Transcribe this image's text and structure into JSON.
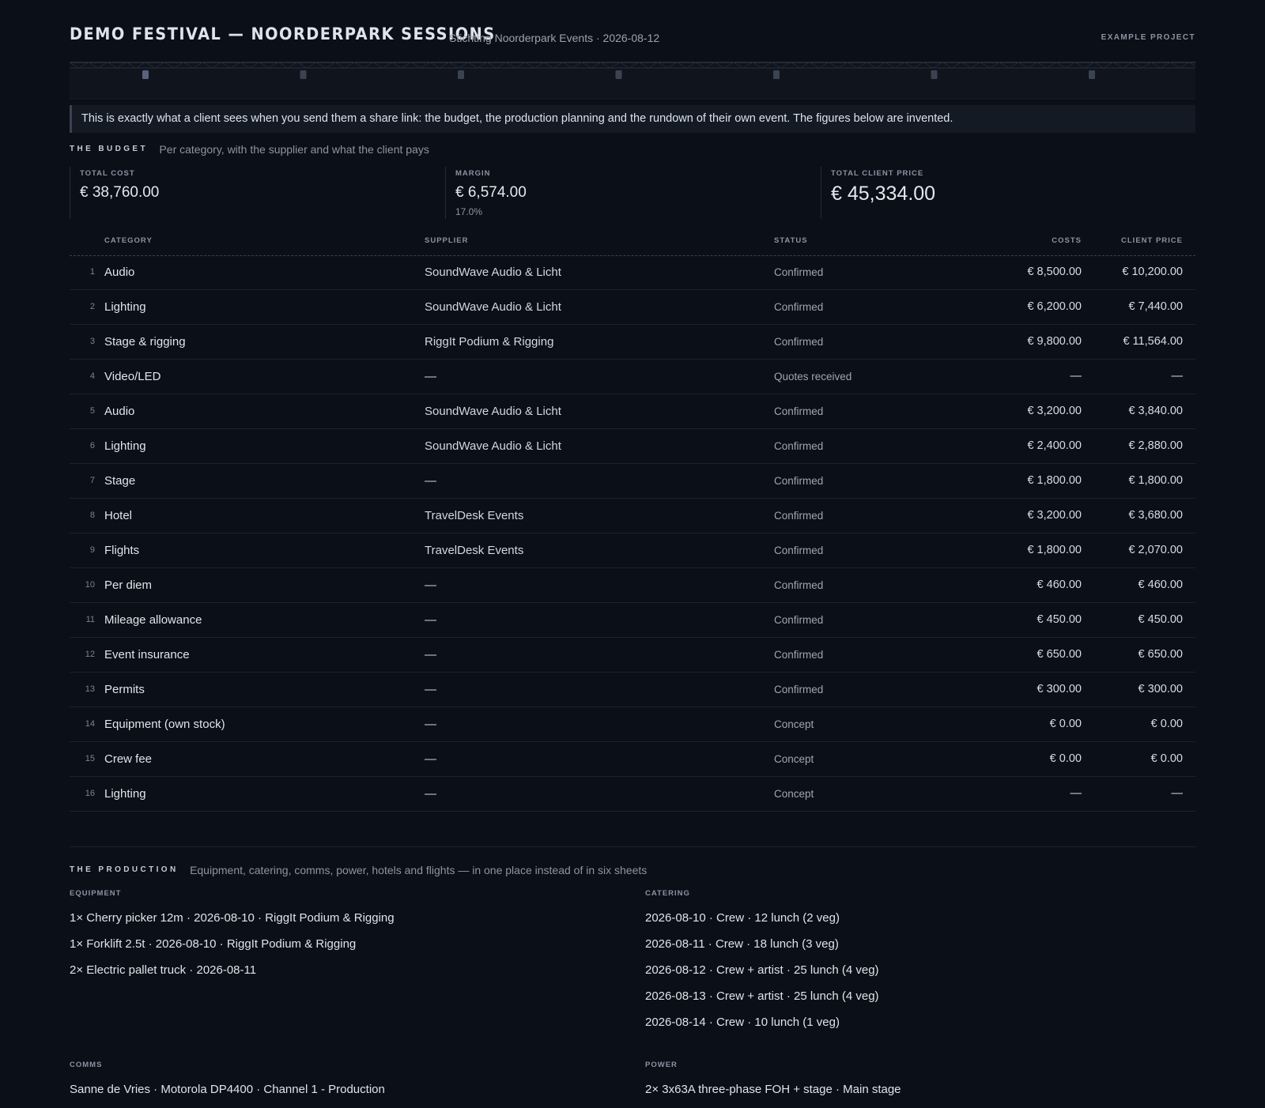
{
  "header": {
    "title": "DEMO FESTIVAL — NOORDERPARK SESSIONS",
    "subtitle": "Stichting Noorderpark Events · 2026-08-12",
    "tag": "EXAMPLE PROJECT"
  },
  "notice": "This is exactly what a client sees when you send them a share link: the budget, the production planning and the rundown of their own event. The figures below are invented.",
  "budget": {
    "heading": "THE BUDGET",
    "description": "Per category, with the supplier and what the client pays",
    "stats": {
      "total_cost": {
        "label": "TOTAL COST",
        "value": "€ 38,760.00"
      },
      "margin": {
        "label": "MARGIN",
        "value": "€ 6,574.00",
        "pct": "17.0%"
      },
      "total_client": {
        "label": "TOTAL CLIENT PRICE",
        "value": "€ 45,334.00"
      }
    },
    "columns": {
      "category": "CATEGORY",
      "supplier": "SUPPLIER",
      "status": "STATUS",
      "costs": "COSTS",
      "client_price": "CLIENT PRICE"
    },
    "rows": [
      {
        "n": "1",
        "category": "Audio",
        "supplier": "SoundWave Audio & Licht",
        "status": "Confirmed",
        "costs": "€ 8,500.00",
        "client": "€ 10,200.00"
      },
      {
        "n": "2",
        "category": "Lighting",
        "supplier": "SoundWave Audio & Licht",
        "status": "Confirmed",
        "costs": "€ 6,200.00",
        "client": "€ 7,440.00"
      },
      {
        "n": "3",
        "category": "Stage & rigging",
        "supplier": "RiggIt Podium & Rigging",
        "status": "Confirmed",
        "costs": "€ 9,800.00",
        "client": "€ 11,564.00"
      },
      {
        "n": "4",
        "category": "Video/LED",
        "supplier": "—",
        "status": "Quotes received",
        "costs": "—",
        "client": "—"
      },
      {
        "n": "5",
        "category": "Audio",
        "supplier": "SoundWave Audio & Licht",
        "status": "Confirmed",
        "costs": "€ 3,200.00",
        "client": "€ 3,840.00"
      },
      {
        "n": "6",
        "category": "Lighting",
        "supplier": "SoundWave Audio & Licht",
        "status": "Confirmed",
        "costs": "€ 2,400.00",
        "client": "€ 2,880.00"
      },
      {
        "n": "7",
        "category": "Stage",
        "supplier": "—",
        "status": "Confirmed",
        "costs": "€ 1,800.00",
        "client": "€ 1,800.00"
      },
      {
        "n": "8",
        "category": "Hotel",
        "supplier": "TravelDesk Events",
        "status": "Confirmed",
        "costs": "€ 3,200.00",
        "client": "€ 3,680.00"
      },
      {
        "n": "9",
        "category": "Flights",
        "supplier": "TravelDesk Events",
        "status": "Confirmed",
        "costs": "€ 1,800.00",
        "client": "€ 2,070.00"
      },
      {
        "n": "10",
        "category": "Per diem",
        "supplier": "—",
        "status": "Confirmed",
        "costs": "€ 460.00",
        "client": "€ 460.00"
      },
      {
        "n": "11",
        "category": "Mileage allowance",
        "supplier": "—",
        "status": "Confirmed",
        "costs": "€ 450.00",
        "client": "€ 450.00"
      },
      {
        "n": "12",
        "category": "Event insurance",
        "supplier": "—",
        "status": "Confirmed",
        "costs": "€ 650.00",
        "client": "€ 650.00"
      },
      {
        "n": "13",
        "category": "Permits",
        "supplier": "—",
        "status": "Confirmed",
        "costs": "€ 300.00",
        "client": "€ 300.00"
      },
      {
        "n": "14",
        "category": "Equipment (own stock)",
        "supplier": "—",
        "status": "Concept",
        "costs": "€ 0.00",
        "client": "€ 0.00"
      },
      {
        "n": "15",
        "category": "Crew fee",
        "supplier": "—",
        "status": "Concept",
        "costs": "€ 0.00",
        "client": "€ 0.00"
      },
      {
        "n": "16",
        "category": "Lighting",
        "supplier": "—",
        "status": "Concept",
        "costs": "—",
        "client": "—"
      }
    ]
  },
  "production": {
    "heading": "THE PRODUCTION",
    "description": "Equipment, catering, comms, power, hotels and flights — in one place instead of in six sheets",
    "equipment": {
      "label": "EQUIPMENT",
      "items": [
        "1× Cherry picker 12m · 2026-08-10 · RiggIt Podium & Rigging",
        "1× Forklift 2.5t · 2026-08-10 · RiggIt Podium & Rigging",
        "2× Electric pallet truck · 2026-08-11"
      ]
    },
    "catering": {
      "label": "CATERING",
      "items": [
        "2026-08-10 · Crew · 12 lunch (2 veg)",
        "2026-08-11 · Crew · 18 lunch (3 veg)",
        "2026-08-12 · Crew + artist · 25 lunch (4 veg)",
        "2026-08-13 · Crew + artist · 25 lunch (4 veg)",
        "2026-08-14 · Crew · 10 lunch (1 veg)"
      ]
    },
    "comms": {
      "label": "COMMS",
      "items": [
        "Sanne de Vries · Motorola DP4400 · Channel 1 - Production"
      ]
    },
    "power": {
      "label": "POWER",
      "items": [
        "2× 3x63A three-phase FOH + stage · Main stage"
      ]
    }
  }
}
